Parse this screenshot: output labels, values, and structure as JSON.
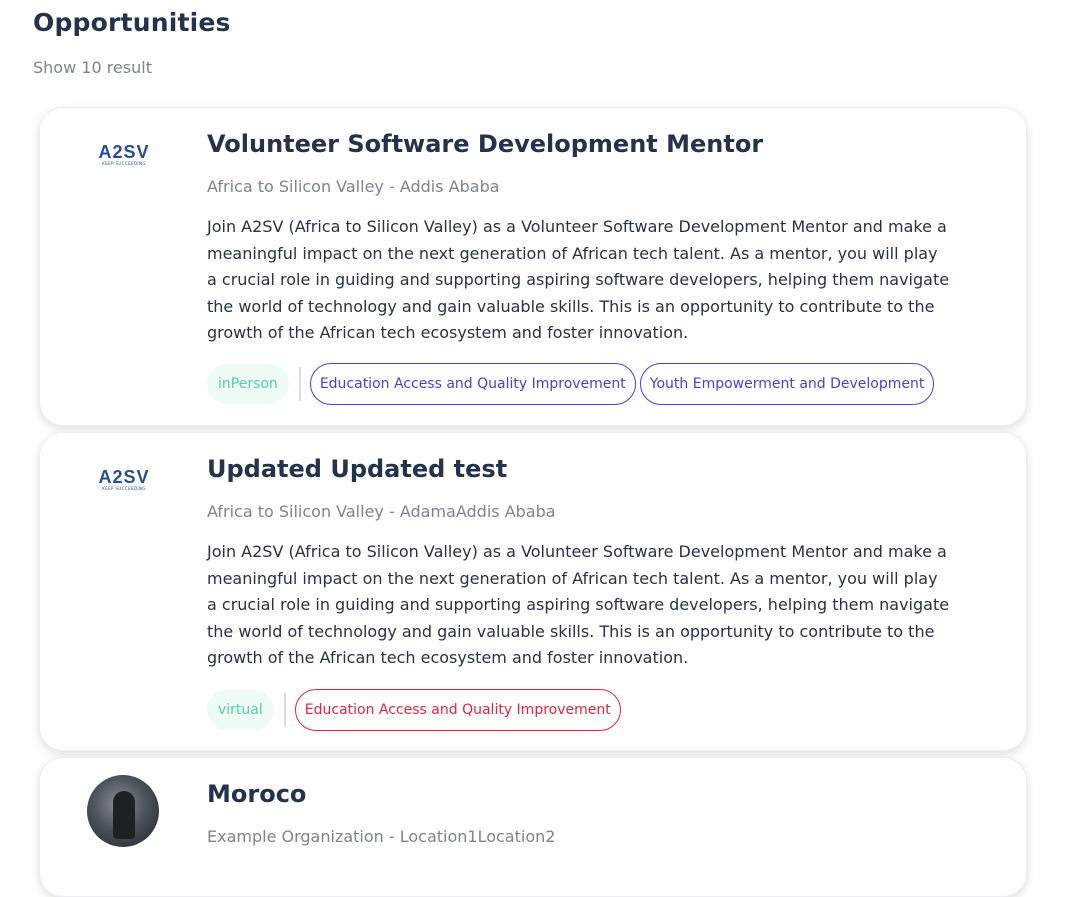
{
  "header": {
    "title": "Opportunities",
    "result_count": "Show 10 result"
  },
  "colors": {
    "heading": "#25324b",
    "muted": "#7c8493",
    "mode_green": "#56cdad",
    "mode_bg": "#effbf5",
    "category_purple": "#4640de",
    "category_red": "#e0263c"
  },
  "opportunities": [
    {
      "logo": {
        "text": "A2SV",
        "tagline": "KEEP SUCCEEDING",
        "icon": "a2sv-logo"
      },
      "title": "Volunteer Software Development Mentor",
      "subtitle": "Africa to Silicon Valley - Addis Ababa",
      "description": "Join A2SV (Africa to Silicon Valley) as a Volunteer Software Development Mentor and make a meaningful impact on the next generation of African tech talent. As a mentor, you will play a crucial role in guiding and supporting aspiring software developers, helping them navigate the world of technology and gain valuable skills. This is an opportunity to contribute to the growth of the African tech ecosystem and foster innovation.",
      "mode": "inPerson",
      "categories": [
        "Education Access and Quality Improvement",
        "Youth Empowerment and Development"
      ]
    },
    {
      "logo": {
        "text": "A2SV",
        "tagline": "KEEP SUCCEEDING",
        "icon": "a2sv-logo"
      },
      "title": "Updated Updated test",
      "subtitle": "Africa to Silicon Valley - AdamaAddis Ababa",
      "description": "Join A2SV (Africa to Silicon Valley) as a Volunteer Software Development Mentor and make a meaningful impact on the next generation of African tech talent. As a mentor, you will play a crucial role in guiding and supporting aspiring software developers, helping them navigate the world of technology and gain valuable skills. This is an opportunity to contribute to the growth of the African tech ecosystem and foster innovation.",
      "mode": "virtual",
      "categories": [
        "Education Access and Quality Improvement"
      ]
    },
    {
      "logo": {
        "icon": "avatar-photo"
      },
      "title": "Moroco",
      "subtitle": "Example Organization - Location1Location2"
    }
  ]
}
